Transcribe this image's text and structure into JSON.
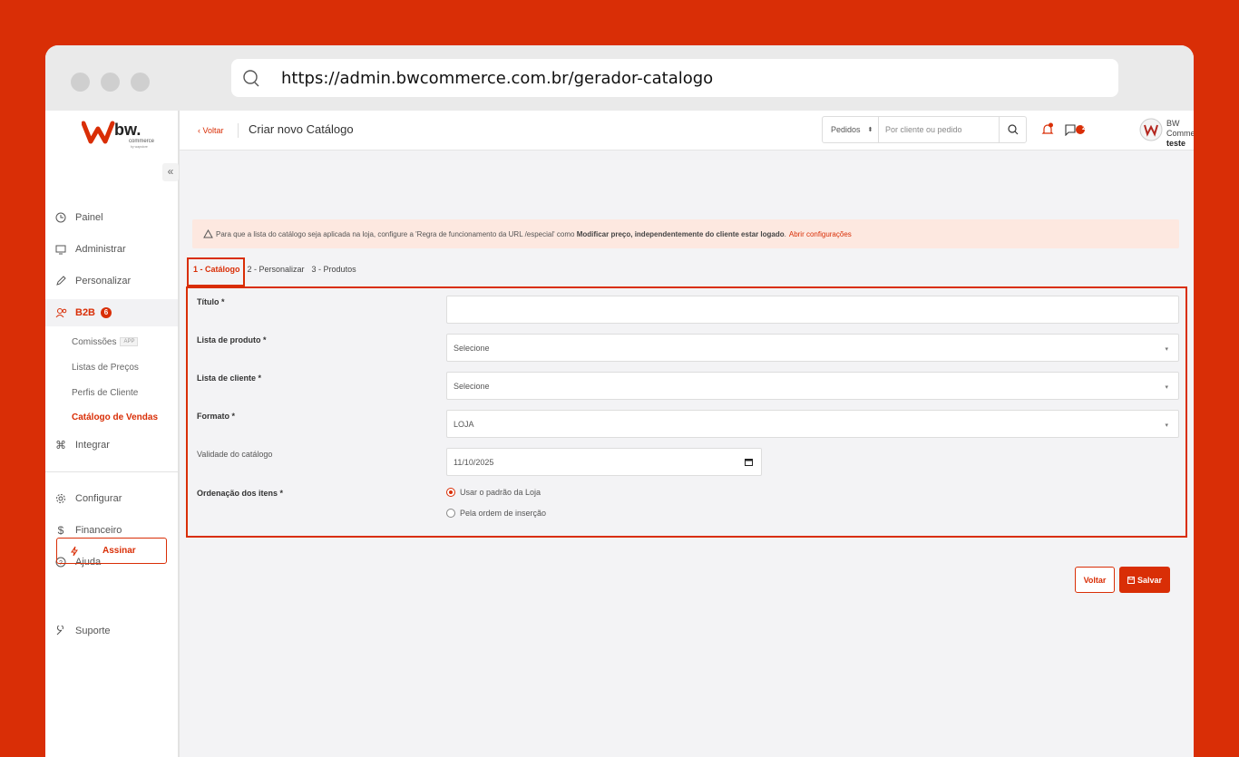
{
  "browser": {
    "url": "https://admin.bwcommerce.com.br/gerador-catalogo"
  },
  "logo": {
    "brand": "bw.",
    "sub": "commerce",
    "by": "by wapstore"
  },
  "sidebar": {
    "collapse": "«",
    "items": [
      {
        "label": "Painel",
        "icon": "clock-icon"
      },
      {
        "label": "Administrar",
        "icon": "monitor-icon"
      },
      {
        "label": "Personalizar",
        "icon": "pen-icon"
      },
      {
        "label": "B2B",
        "icon": "users-icon",
        "badge": "6"
      },
      {
        "label": "Integrar",
        "icon": "command-icon"
      },
      {
        "label": "Configurar",
        "icon": "gear-icon"
      },
      {
        "label": "Financeiro",
        "icon": "dollar-icon"
      },
      {
        "label": "Ajuda",
        "icon": "help-icon"
      },
      {
        "label": "Suporte",
        "icon": "wrench-icon"
      }
    ],
    "b2b_sub": [
      {
        "label": "Comissões",
        "tag": "APP"
      },
      {
        "label": "Listas de Preços"
      },
      {
        "label": "Perfis de Cliente"
      },
      {
        "label": "Catálogo de Vendas"
      }
    ],
    "assinar": "Assinar"
  },
  "topbar": {
    "back": "‹ Voltar",
    "title": "Criar novo Catálogo",
    "search_select": "Pedidos",
    "search_placeholder": "Por cliente ou pedido",
    "chat_badge": "2",
    "user_name": "BW Commerce",
    "user_sub": "teste"
  },
  "alert": {
    "prefix": "Para que a lista do catálogo seja aplicada na loja, configure a 'Regra de funcionamento da URL /especial' como",
    "bold": "Modificar preço, independentemente do cliente estar logado",
    "suffix": ".",
    "link": "Abrir configurações"
  },
  "steps": [
    "1 - Catálogo",
    "2 - Personalizar",
    "3 - Produtos"
  ],
  "form": {
    "titulo_label": "Título *",
    "titulo_value": "",
    "lista_produto_label": "Lista de produto *",
    "lista_produto_value": "Selecione",
    "lista_cliente_label": "Lista de cliente *",
    "lista_cliente_value": "Selecione",
    "formato_label": "Formato *",
    "formato_value": "LOJA",
    "validade_label": "Validade do catálogo",
    "validade_value": "11/10/2025",
    "ordenacao_label": "Ordenação dos itens *",
    "radio_1": "Usar o padrão da Loja",
    "radio_2": "Pela ordem de inserção"
  },
  "actions": {
    "voltar": "Voltar",
    "salvar": "Salvar"
  },
  "colors": {
    "accent": "#d92e06",
    "alert_bg": "#fde8e0"
  }
}
